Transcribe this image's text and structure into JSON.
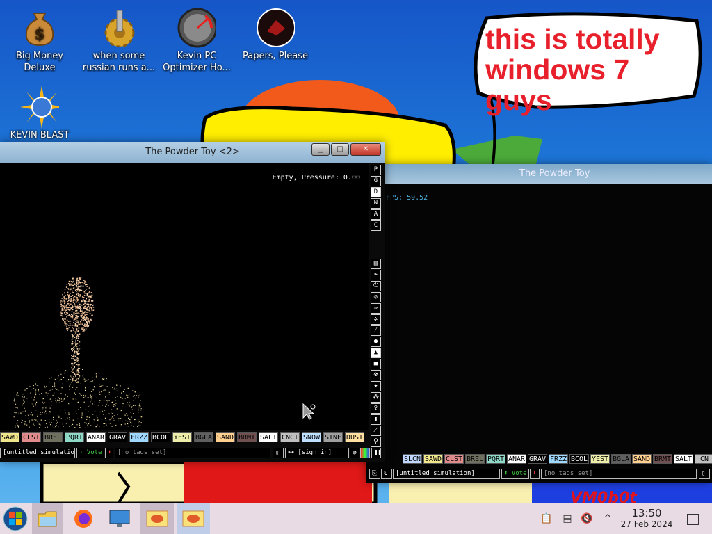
{
  "desktop": {
    "icons": [
      {
        "label": "Big Money Deluxe",
        "icon": "money-bag-icon"
      },
      {
        "label": "when some russian runs a...",
        "icon": "gear-icon"
      },
      {
        "label": "Kevin PC Optimizer Ho...",
        "icon": "speedometer-icon"
      },
      {
        "label": "Papers, Please",
        "icon": "papers-please-icon"
      },
      {
        "label": "KEVIN BLAST",
        "icon": "blast-icon"
      }
    ],
    "speech_bubble": "this is totally windows 7 guys",
    "watermark": "VM0b0t"
  },
  "window_front": {
    "title": "The Powder Toy <2>",
    "status": "Empty, Pressure: 0.00",
    "side_menu_top": [
      "P",
      "G",
      "D",
      "N",
      "A",
      "C"
    ],
    "selected_side_top": "D",
    "elements": [
      {
        "label": "SAWD",
        "bg": "#f0e68c",
        "fg": "#000"
      },
      {
        "label": "CLST",
        "bg": "#e08c8c",
        "fg": "#000"
      },
      {
        "label": "BREL",
        "bg": "#707060",
        "fg": "#000"
      },
      {
        "label": "PQRT",
        "bg": "#8ed9c7",
        "fg": "#000"
      },
      {
        "label": "ANAR",
        "bg": "#ffffff",
        "fg": "#000"
      },
      {
        "label": "GRAV",
        "bg": "#000000",
        "fg": "#fff"
      },
      {
        "label": "FRZZ",
        "bg": "#9fd8ff",
        "fg": "#000"
      },
      {
        "label": "BCOL",
        "bg": "#000000",
        "fg": "#fff"
      },
      {
        "label": "YEST",
        "bg": "#eeeeaa",
        "fg": "#000"
      },
      {
        "label": "BGLA",
        "bg": "#606060",
        "fg": "#000"
      },
      {
        "label": "SAND",
        "bg": "#ffd090",
        "fg": "#000"
      },
      {
        "label": "BRMT",
        "bg": "#705050",
        "fg": "#000"
      },
      {
        "label": "SALT",
        "bg": "#ffffff",
        "fg": "#000"
      },
      {
        "label": "CNCT",
        "bg": "#c0c0c0",
        "fg": "#000"
      },
      {
        "label": "SNOW",
        "bg": "#c0e0ff",
        "fg": "#000"
      },
      {
        "label": "STNE",
        "bg": "#a0a0a0",
        "fg": "#000"
      },
      {
        "label": "DUST",
        "bg": "#ffe0a0",
        "fg": "#000"
      }
    ],
    "save_name": "[untitled simulation]",
    "vote_label": "Vote",
    "tags": "[no tags set]",
    "sign_in": "[sign in]"
  },
  "window_back": {
    "title": "The Powder Toy",
    "fps_text": "FPS: 59.52",
    "elements": [
      {
        "label": "SLCN",
        "bg": "#c0d8ff",
        "fg": "#000"
      },
      {
        "label": "SAWD",
        "bg": "#f0e68c",
        "fg": "#000"
      },
      {
        "label": "CLST",
        "bg": "#e08c8c",
        "fg": "#000"
      },
      {
        "label": "BREL",
        "bg": "#707060",
        "fg": "#000"
      },
      {
        "label": "PQRT",
        "bg": "#8ed9c7",
        "fg": "#000"
      },
      {
        "label": "ANAR",
        "bg": "#ffffff",
        "fg": "#000"
      },
      {
        "label": "GRAV",
        "bg": "#000000",
        "fg": "#fff"
      },
      {
        "label": "FRZZ",
        "bg": "#9fd8ff",
        "fg": "#000"
      },
      {
        "label": "BCOL",
        "bg": "#000000",
        "fg": "#fff"
      },
      {
        "label": "YEST",
        "bg": "#eeeeaa",
        "fg": "#000"
      },
      {
        "label": "BGLA",
        "bg": "#606060",
        "fg": "#000"
      },
      {
        "label": "SAND",
        "bg": "#ffd090",
        "fg": "#000"
      },
      {
        "label": "BRMT",
        "bg": "#705050",
        "fg": "#000"
      },
      {
        "label": "SALT",
        "bg": "#ffffff",
        "fg": "#000"
      },
      {
        "label": "CN",
        "bg": "#c0c0c0",
        "fg": "#000"
      }
    ],
    "save_name": "[untitled simulation]",
    "vote_label": "Vote",
    "tags": "[no tags set]"
  },
  "taskbar": {
    "time": "13:50",
    "date": "27 Feb 2024"
  }
}
